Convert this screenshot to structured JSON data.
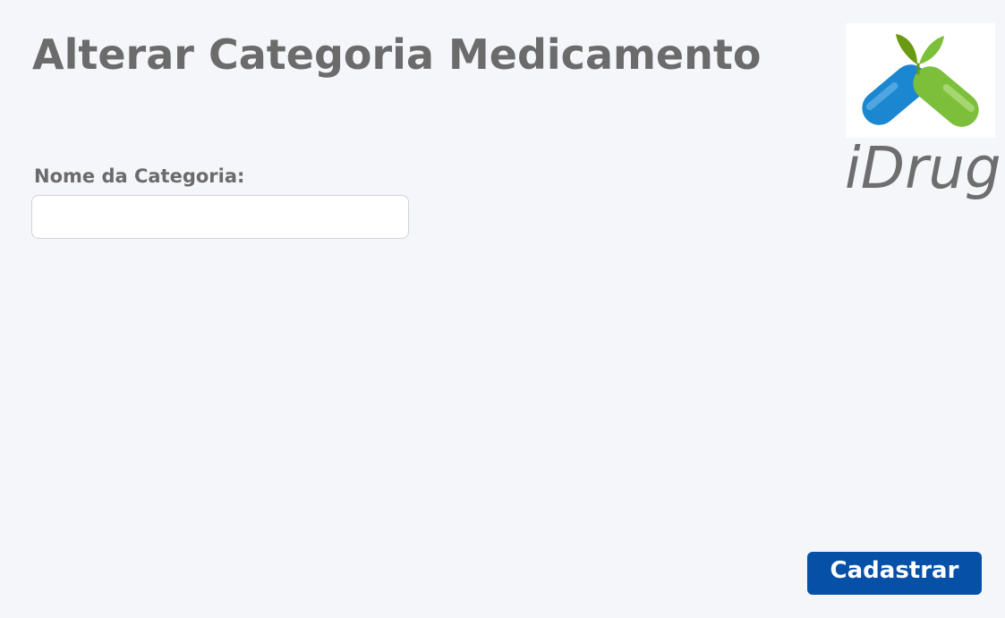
{
  "page": {
    "title": "Alterar Categoria Medicamento"
  },
  "brand": {
    "name": "iDrug",
    "logo_icon": "pill-leaf-logo-icon",
    "colors": {
      "blue": "#1b87d0",
      "green": "#7cbf3a",
      "dark_green": "#6a9a12",
      "text": "#6e6e6e"
    }
  },
  "form": {
    "category_name_label": "Nome da Categoria:",
    "category_name_value": "",
    "category_name_placeholder": ""
  },
  "actions": {
    "submit_label": "Cadastrar",
    "submit_color": "#0650a8"
  }
}
